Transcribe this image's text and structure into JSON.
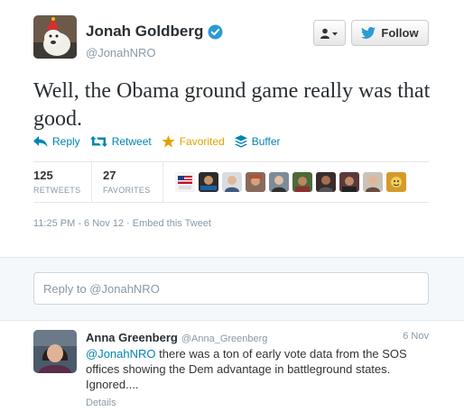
{
  "colors": {
    "link": "#0084b4",
    "favorite": "#e1a200",
    "muted": "#8899a6",
    "verified": "#2b9bd6"
  },
  "tweet": {
    "author_name": "Jonah Goldberg",
    "author_handle": "@JonahNRO",
    "verified": true,
    "follow_label": "Follow",
    "text": "Well, the Obama ground game really was that good.",
    "actions": {
      "reply": "Reply",
      "retweet": "Retweet",
      "favorite": "Favorited",
      "buffer": "Buffer"
    },
    "stats": {
      "retweets": {
        "count": "125",
        "label": "RETWEETS"
      },
      "favorites": {
        "count": "27",
        "label": "FAVORITES"
      }
    },
    "timestamp": "11:25 PM - 6 Nov 12",
    "embed_label": "Embed this Tweet"
  },
  "reply_box": {
    "placeholder": "Reply to @JonahNRO"
  },
  "reply": {
    "author_name": "Anna Greenberg",
    "author_handle": "@Anna_Greenberg",
    "date": "6 Nov",
    "mention": "@JonahNRO",
    "text": " there was a ton of early vote data from the SOS offices showing the Dem advantage in battleground states. Ignored....",
    "details_label": "Details"
  }
}
